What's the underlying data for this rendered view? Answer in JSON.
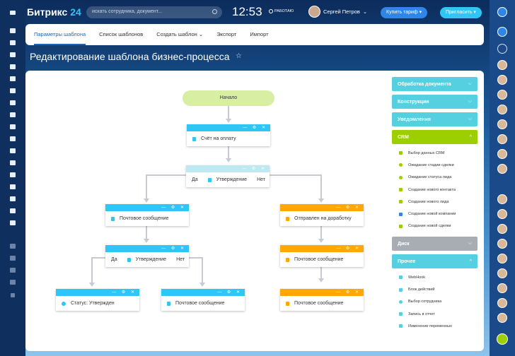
{
  "app": {
    "logo": "Битрикс",
    "logo_num": "24"
  },
  "header": {
    "search_placeholder": "искать сотрудника, документ...",
    "time": "12:53",
    "work_status": "РАБОТАЮ",
    "user_name": "Сергей Петров",
    "tariff_label": "Купить тариф",
    "invite_label": "Пригласить"
  },
  "tabs": [
    {
      "label": "Параметры шаблона"
    },
    {
      "label": "Список шаблонов"
    },
    {
      "label": "Создать шаблон"
    },
    {
      "label": "Экспорт"
    },
    {
      "label": "Импорт"
    }
  ],
  "page_title": "Редактирование шаблона бизнес-процесса",
  "workflow": {
    "start": "Начало",
    "invoice": "Счёт на оплату",
    "approve_1": "Утверждение",
    "yes": "Да",
    "no": "Нет",
    "mail_left": "Почтовое сообщение",
    "revision": "Отправлен на доработку",
    "approve_2": "Утверждение",
    "mail_right": "Почтовое сообщение",
    "status": "Статус: Утвержден",
    "mail_bottom_mid": "Почтовое сообщение",
    "mail_bottom_right": "Почтовое сообщение",
    "controls": "— ⚙ ✕"
  },
  "panel": {
    "sections": [
      {
        "label": "Обработка документа"
      },
      {
        "label": "Конструкции"
      },
      {
        "label": "Уведомления"
      },
      {
        "label": "CRM"
      },
      {
        "label": "Диск"
      },
      {
        "label": "Прочее"
      }
    ],
    "crm_items": [
      {
        "label": "Выбор данных CRM"
      },
      {
        "label": "Ожидание стадии сделки"
      },
      {
        "label": "Ожидание статуса лида"
      },
      {
        "label": "Создание нового контакта"
      },
      {
        "label": "Создание нового лида"
      },
      {
        "label": "Создание новой компании"
      },
      {
        "label": "Создание новой сделки"
      }
    ],
    "other_items": [
      {
        "label": "WebHook"
      },
      {
        "label": "Блок действий"
      },
      {
        "label": "Выбор сотрудника"
      },
      {
        "label": "Запись в отчет"
      },
      {
        "label": "Изменение переменных"
      }
    ]
  },
  "colors": {
    "accent": "#2fc6f6",
    "orange": "#ffa900",
    "crm_green": "#9dcf00",
    "section": "#55d0e0",
    "tab_active": "#2067b0"
  }
}
